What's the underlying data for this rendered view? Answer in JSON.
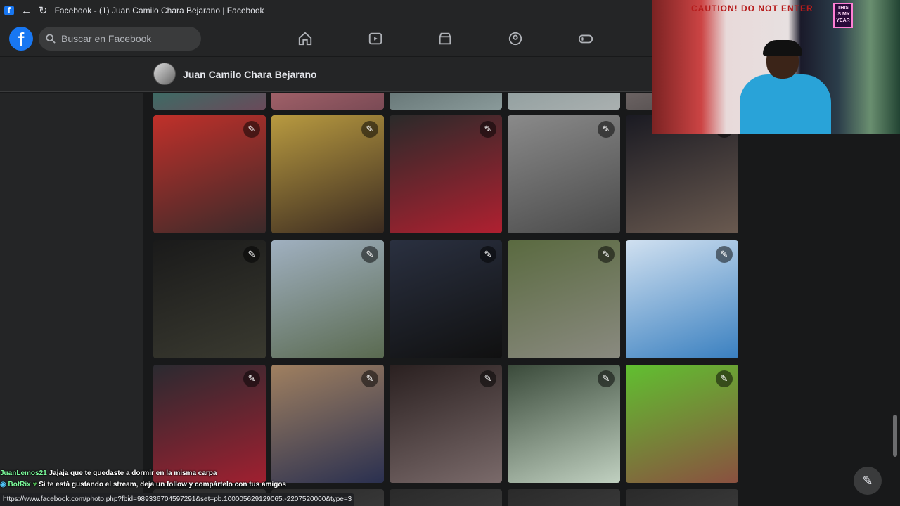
{
  "browser": {
    "tab_title": "Facebook - (1) Juan Camilo Chara Bejarano | Facebook"
  },
  "nav": {
    "logo_letter": "f",
    "search_placeholder": "Buscar en Facebook",
    "icons": [
      "home-icon",
      "watch-icon",
      "marketplace-icon",
      "groups-icon",
      "gaming-icon"
    ]
  },
  "profile": {
    "name": "Juan Camilo Chara Bejarano"
  },
  "photos": [
    {
      "colors": [
        "#2a7a6a",
        "#6a4a5a"
      ]
    },
    {
      "colors": [
        "#b06a70",
        "#7a4a55"
      ]
    },
    {
      "colors": [
        "#5a6a6a",
        "#8a9a9a"
      ]
    },
    {
      "colors": [
        "#8a9a9a",
        "#aab0b0"
      ]
    },
    {
      "colors": [
        "#7a7070",
        "#4a4545"
      ]
    },
    {
      "colors": [
        "#c0302a",
        "#3a2a2a"
      ]
    },
    {
      "colors": [
        "#b89a40",
        "#3a2a20"
      ]
    },
    {
      "colors": [
        "#2a2a2a",
        "#b02030"
      ]
    },
    {
      "colors": [
        "#8a8a8a",
        "#4a4a4a"
      ]
    },
    {
      "colors": [
        "#1a1a22",
        "#6a5a50"
      ]
    },
    {
      "colors": [
        "#1a1a1a",
        "#3a3a30"
      ]
    },
    {
      "colors": [
        "#a0b0c0",
        "#5a6a50"
      ]
    },
    {
      "colors": [
        "#2a3040",
        "#101010"
      ]
    },
    {
      "colors": [
        "#5a6a40",
        "#8a8a80"
      ]
    },
    {
      "colors": [
        "#d0e0f0",
        "#3a80c0"
      ]
    },
    {
      "colors": [
        "#2a2a30",
        "#a02030"
      ]
    },
    {
      "colors": [
        "#a08060",
        "#2a3050"
      ]
    },
    {
      "colors": [
        "#2a2020",
        "#7a6a6a"
      ]
    },
    {
      "colors": [
        "#3a4a3a",
        "#c0d0c0"
      ]
    },
    {
      "colors": [
        "#60c030",
        "#8a5040"
      ]
    },
    {
      "colors": [
        "#2a2a2a",
        "#3a3a3a"
      ]
    },
    {
      "colors": [
        "#2a2a2a",
        "#3a3a3a"
      ]
    },
    {
      "colors": [
        "#2a2a2a",
        "#3a3a3a"
      ]
    },
    {
      "colors": [
        "#2a2a2a",
        "#3a3a3a"
      ]
    },
    {
      "colors": [
        "#2a2a2a",
        "#3a3a3a"
      ]
    }
  ],
  "webcam": {
    "sign_text": "CAUTION! DO NOT ENTER",
    "neon_text": "THIS IS MY YEAR"
  },
  "chat": [
    {
      "user": "JuanLemos21",
      "message": "Jajaja que te quedaste a dormir en la misma carpa"
    },
    {
      "user": "BotRix",
      "message": "Si te está gustando el stream, deja un follow y compártelo con tus amigos"
    }
  ],
  "status_url": "https://www.facebook.com/photo.php?fbid=989336704597291&set=pb.100005629129065.-2207520000&type=3"
}
